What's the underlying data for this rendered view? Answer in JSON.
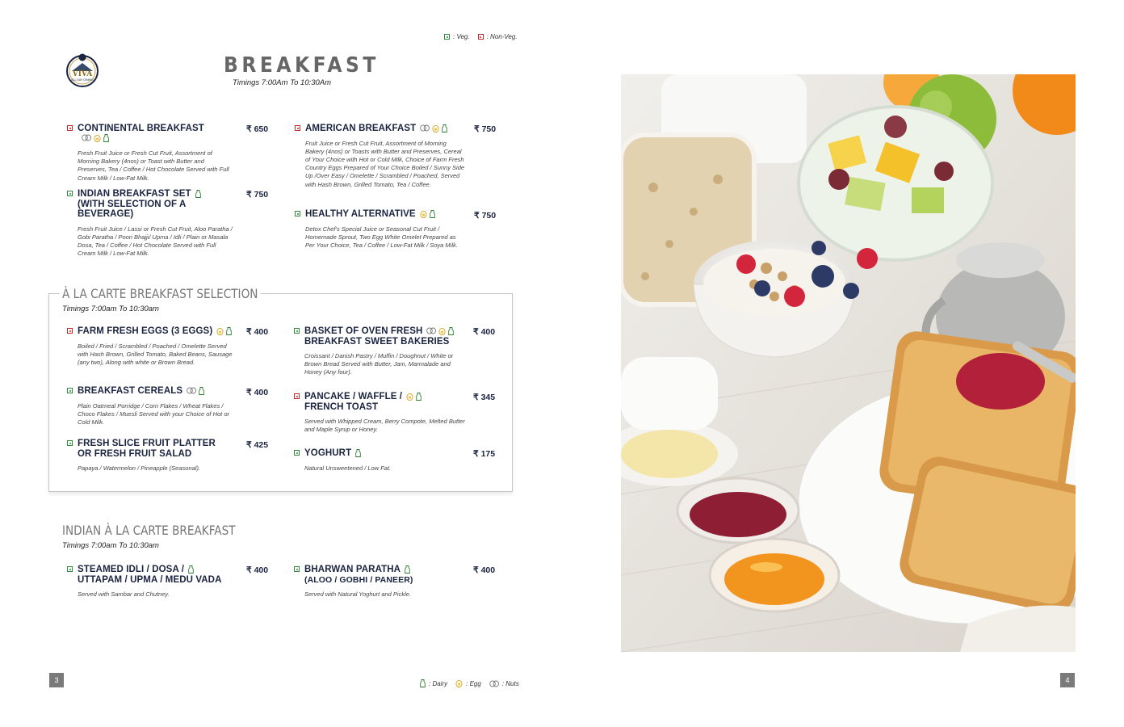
{
  "legend_top": {
    "veg": ": Veg.",
    "nonveg": ": Non-Veg."
  },
  "legend_bottom": {
    "dairy": ": Dairy",
    "egg": ": Egg",
    "nuts": ": Nuts"
  },
  "logo": {
    "name": "VIVA",
    "tagline": "ALL DAY DINING"
  },
  "title": "BREAKFAST",
  "title_timing": "Timings 7:00Am To 10:30Am",
  "set_menu": [
    {
      "name": "CONTINENTAL BREAKFAST",
      "price": "₹ 650",
      "type": "nonveg",
      "icons": [
        "nuts",
        "egg",
        "dairy"
      ],
      "desc": "Fresh Fruit Juice or Fresh Cut Fruit, Assortment of Morning Bakery (4nos) or Toast with Butter and Preserves, Tea / Coffee / Hot Chocolate Served with Full Cream Milk / Low-Fat Milk."
    },
    {
      "name": "INDIAN BREAKFAST SET",
      "name2": "(WITH SELECTION OF A BEVERAGE)",
      "price": "₹ 750",
      "type": "veg",
      "icons": [
        "dairy"
      ],
      "desc": "Fresh Fruit Juice / Lassi or Fresh Cut Fruit, Aloo Paratha / Gobi Paratha / Poori Bhajji/ Upma / Idli / Plain or Masala Dosa, Tea / Coffee / Hot Chocolate Served with Full Cream Milk / Low-Fat Milk."
    },
    {
      "name": "AMERICAN BREAKFAST",
      "price": "₹ 750",
      "type": "nonveg",
      "icons": [
        "nuts",
        "egg",
        "dairy"
      ],
      "desc": "Fruit Juice or Fresh Cut Fruit, Assortment of Morning Bakery (4nos) or Toasts with Butter and Preserves, Cereal of Your Choice with Hot or Cold Milk, Choice of Farm Fresh Country Eggs Prepared of Your Choice Boiled / Sunny Side Up /Over Easy / Omelette / Scrambled / Poached, Served with Hash Brown, Grilled Tomato, Tea / Coffee."
    },
    {
      "name": "HEALTHY ALTERNATIVE",
      "price": "₹ 750",
      "type": "veg",
      "icons": [
        "egg",
        "dairy"
      ],
      "desc": "Detox Chef's Special Juice or Seasonal Cut Fruit / Homemade Sprout, Two Egg White Omelet Prepared as Per Your Choice, Tea / Coffee / Low-Fat Milk / Soya Milk."
    }
  ],
  "a_la_carte": {
    "title": "À LA CARTE BREAKFAST SELECTION",
    "timing": "Timings 7:00am To 10:30am",
    "items": [
      {
        "name": "FARM FRESH EGGS (3 EGGS)",
        "price": "₹ 400",
        "type": "nonveg",
        "icons": [
          "egg",
          "dairy"
        ],
        "desc": "Boiled / Fried / Scrambled / Poached / Omelette Served with Hash Brown, Grilled Tomato, Baked Beans, Sausage (any two), Along with white or Brown Bread."
      },
      {
        "name": "BREAKFAST CEREALS",
        "price": "₹ 400",
        "type": "veg",
        "icons": [
          "nuts",
          "dairy"
        ],
        "desc": "Plain Oatmeal Porridge / Corn Flakes / Wheat Flakes / Choco Flakes / Muesli Served with your Choice of Hot or Cold Milk."
      },
      {
        "name": "FRESH SLICE FRUIT PLATTER",
        "name2": "OR FRESH FRUIT SALAD",
        "price": "₹ 425",
        "type": "veg",
        "icons": [],
        "desc": "Papaya / Watermelon / Pineapple (Seasonal)."
      },
      {
        "name": "BASKET OF OVEN FRESH",
        "name2": "BREAKFAST SWEET BAKERIES",
        "price": "₹ 400",
        "type": "veg",
        "icons": [
          "nuts",
          "egg",
          "dairy"
        ],
        "desc": "Croissant / Danish Pastry / Muffin / Doughnut / White or Brown Bread Served with Butter, Jam, Marmalade and Honey (Any four)."
      },
      {
        "name": "PANCAKE / WAFFLE /",
        "name2": "FRENCH TOAST",
        "price": "₹ 345",
        "type": "nonveg",
        "icons": [
          "egg",
          "dairy"
        ],
        "desc": "Served with Whipped Cream, Berry Compote, Melted Butter and Maple Syrup or Honey."
      },
      {
        "name": "YOGHURT",
        "price": "₹ 175",
        "type": "veg",
        "icons": [
          "dairy"
        ],
        "desc": "Natural Unsweetened / Low Fat."
      }
    ]
  },
  "indian": {
    "title": "INDIAN À LA CARTE BREAKFAST",
    "timing": "Timings 7:00am To 10:30am",
    "items": [
      {
        "name": "STEAMED IDLI / DOSA /",
        "name2": "UTTAPAM / UPMA / MEDU VADA",
        "price": "₹ 400",
        "type": "veg",
        "icons": [
          "dairy"
        ],
        "desc": "Served with Sambar and Chutney."
      },
      {
        "name": "BHARWAN PARATHA",
        "name2": "(ALOO / GOBHI / PANEER)",
        "price": "₹ 400",
        "type": "veg",
        "icons": [
          "dairy"
        ],
        "desc": "Served with Natural Yoghurt and Pickle."
      }
    ]
  },
  "page_left": "3",
  "page_right": "4",
  "colors": {
    "veg": "#2e8b3e",
    "nonveg": "#c62828",
    "navy": "#1a2340"
  }
}
